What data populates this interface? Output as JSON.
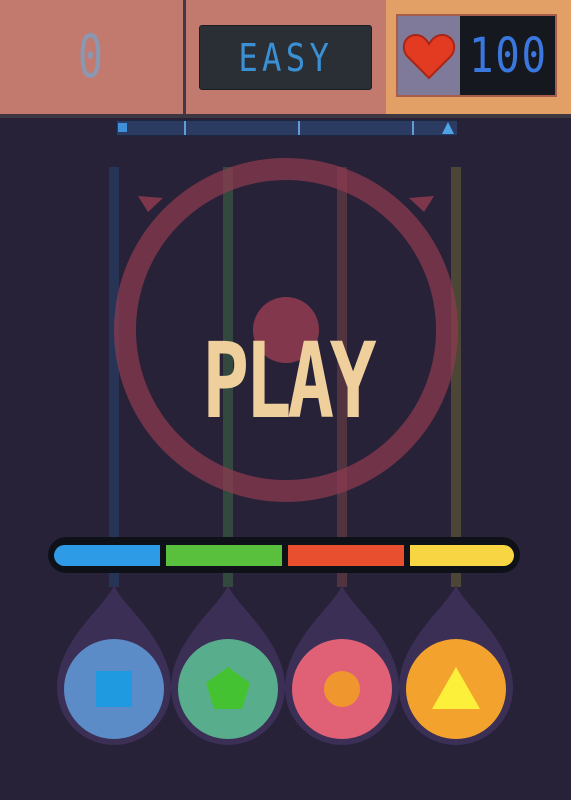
{
  "hud": {
    "score": "0",
    "difficulty": "EASY",
    "health_icon": "heart-icon",
    "health": "100"
  },
  "start_button": {
    "label": "PLAY"
  },
  "lanes": [
    {
      "name": "blue",
      "color": "#2d9be6",
      "shape": "square-icon"
    },
    {
      "name": "green",
      "color": "#58c03d",
      "shape": "pentagon-icon"
    },
    {
      "name": "red",
      "color": "#e74f2e",
      "shape": "circle-icon"
    },
    {
      "name": "yellow",
      "color": "#f8d643",
      "shape": "triangle-icon"
    }
  ]
}
